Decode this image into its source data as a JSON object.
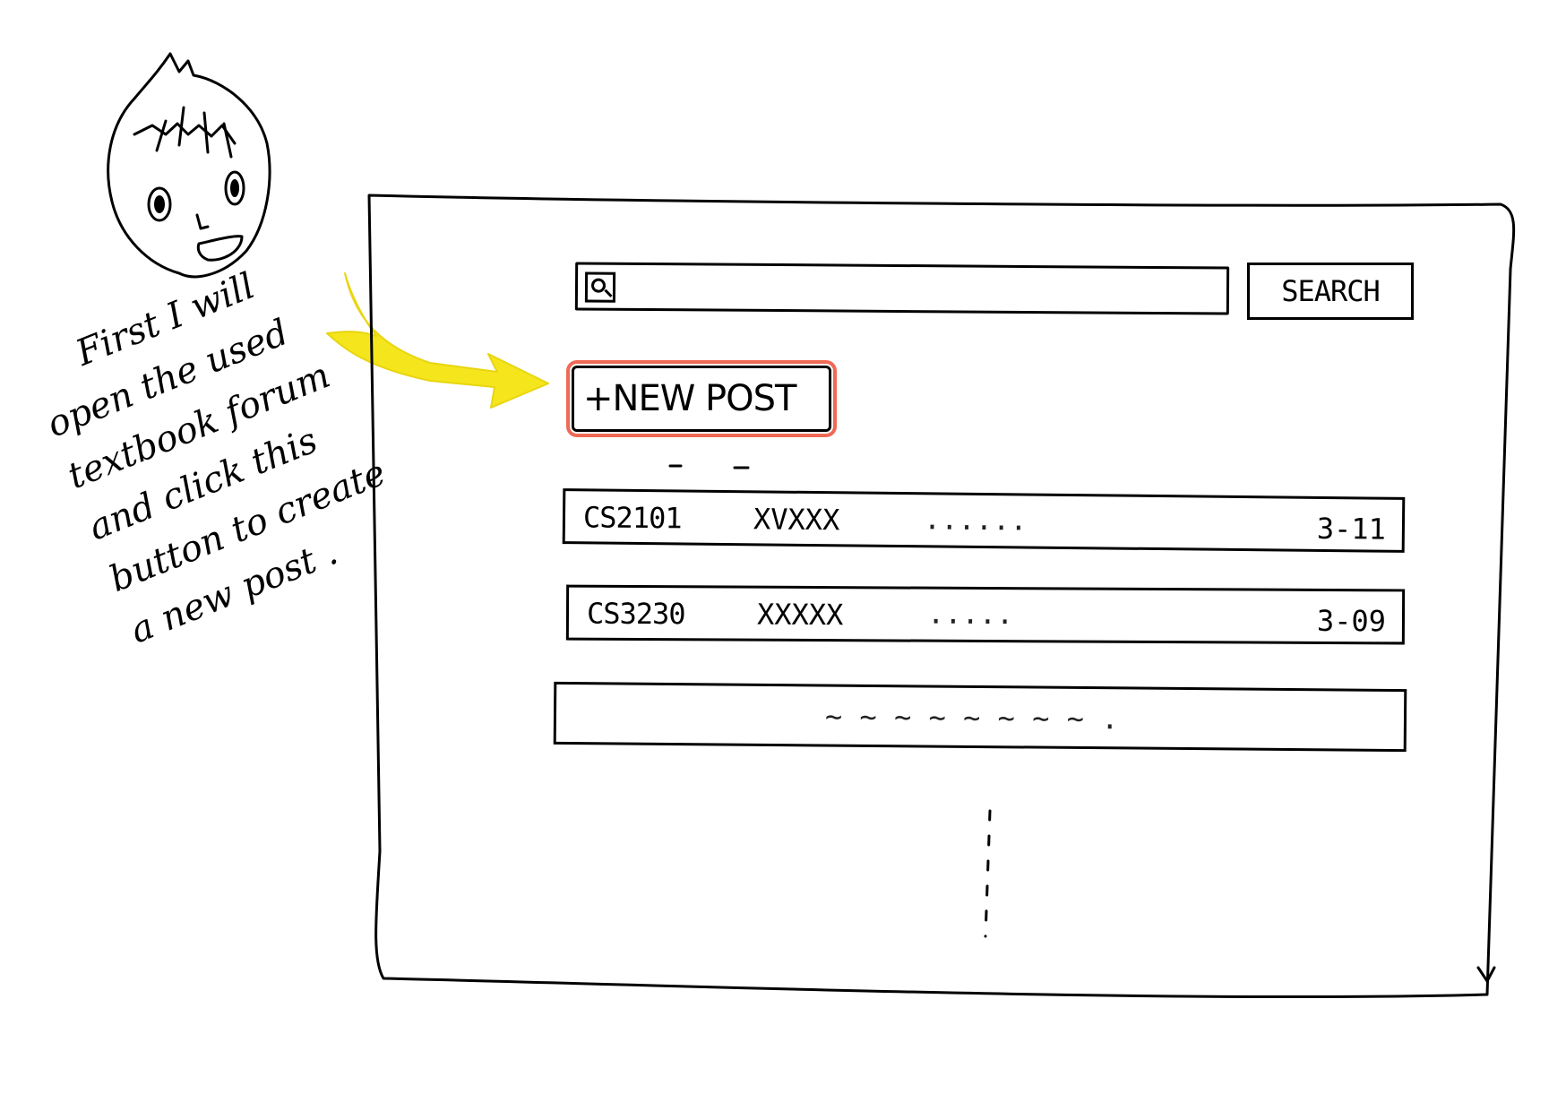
{
  "note": {
    "lines": [
      "First I will",
      "open the used",
      "textbook forum",
      "and click this",
      "button to create",
      "a new post ."
    ]
  },
  "mockup": {
    "search": {
      "button_label": "SEARCH",
      "placeholder": ""
    },
    "new_post_label": "+NEW POST",
    "posts": [
      {
        "course": "CS2101",
        "title": "XVXXX",
        "preview": "......",
        "date": "3-11"
      },
      {
        "course": "CS3230",
        "title": "XXXXX",
        "preview": ".....",
        "date": "3-09"
      },
      {
        "course": "",
        "title": "",
        "preview": "~ ~ ~ ~ ~   ~ ~ ~ .",
        "date": ""
      }
    ],
    "more_indicator": "⋮"
  },
  "colors": {
    "ink": "#000000",
    "highlight": "#ef6a55",
    "arrow": "#f5e51d"
  }
}
